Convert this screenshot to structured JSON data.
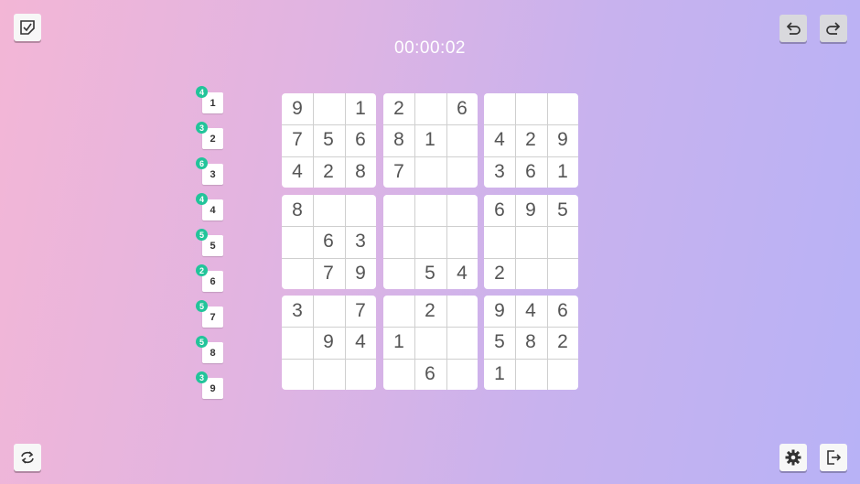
{
  "timer": "00:00:02",
  "toolbar": {
    "top_left": {
      "icon": "checklist-icon",
      "label": ""
    },
    "top_right": [
      {
        "icon": "undo-icon"
      },
      {
        "icon": "redo-icon"
      }
    ],
    "bottom_left": {
      "icon": "restart-icon"
    },
    "bottom_right": [
      {
        "icon": "gear-icon"
      },
      {
        "icon": "exit-icon"
      }
    ]
  },
  "number_tiles": [
    {
      "digit": "1",
      "remaining": "4"
    },
    {
      "digit": "2",
      "remaining": "3"
    },
    {
      "digit": "3",
      "remaining": "6"
    },
    {
      "digit": "4",
      "remaining": "4"
    },
    {
      "digit": "5",
      "remaining": "5"
    },
    {
      "digit": "6",
      "remaining": "2"
    },
    {
      "digit": "7",
      "remaining": "5"
    },
    {
      "digit": "8",
      "remaining": "5"
    },
    {
      "digit": "9",
      "remaining": "3"
    }
  ],
  "grid": [
    [
      "9",
      "",
      "1",
      "2",
      "",
      "6",
      "",
      "",
      ""
    ],
    [
      "7",
      "5",
      "6",
      "8",
      "1",
      "",
      "4",
      "2",
      "9"
    ],
    [
      "4",
      "2",
      "8",
      "7",
      "",
      "",
      "3",
      "6",
      "1"
    ],
    [
      "8",
      "",
      "",
      "",
      "",
      "",
      "6",
      "9",
      "5"
    ],
    [
      "",
      "6",
      "3",
      "",
      "",
      "",
      "",
      "",
      ""
    ],
    [
      "",
      "7",
      "9",
      "",
      "5",
      "4",
      "2",
      "",
      ""
    ],
    [
      "3",
      "",
      "7",
      "",
      "2",
      "",
      "9",
      "4",
      "6"
    ],
    [
      "",
      "9",
      "4",
      "1",
      "",
      "",
      "5",
      "8",
      "2"
    ],
    [
      "",
      "",
      "",
      "",
      "6",
      "",
      "1",
      "",
      ""
    ]
  ],
  "colors": {
    "badge": "#22c49a",
    "digit": "#555555"
  }
}
